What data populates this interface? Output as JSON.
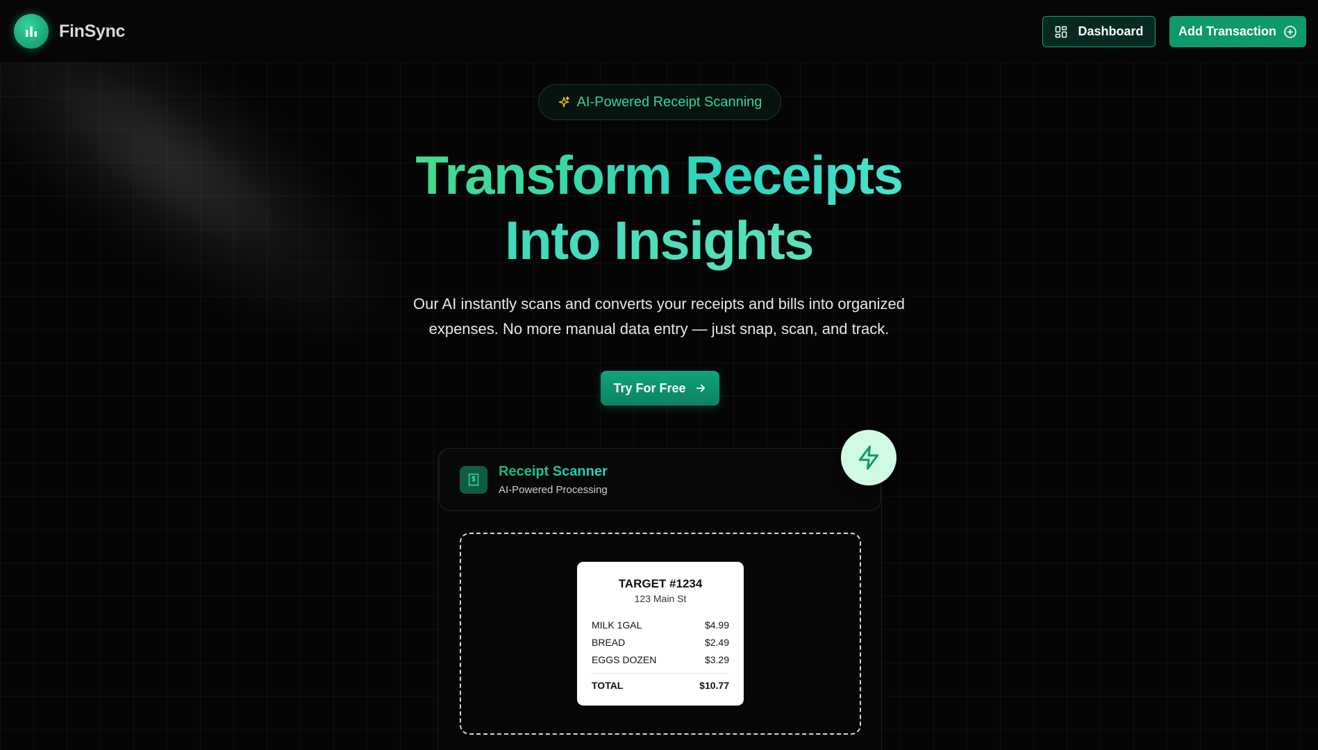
{
  "header": {
    "brand": "FinSync",
    "dashboard_label": "Dashboard",
    "add_transaction_label": "Add Transaction"
  },
  "hero": {
    "badge": "AI-Powered Receipt Scanning",
    "title_line1": "Transform Receipts",
    "title_line2": "Into Insights",
    "subtitle_line1": "Our AI instantly scans and converts your receipts and bills into organized",
    "subtitle_line2": "expenses. No more manual data entry — just snap, scan, and track.",
    "cta_label": "Try For Free"
  },
  "scanner": {
    "title": "Receipt Scanner",
    "subtitle": "AI-Powered Processing",
    "receipt": {
      "store": "TARGET #1234",
      "address": "123 Main St",
      "items": [
        {
          "name": "MILK 1GAL",
          "price": "$4.99"
        },
        {
          "name": "BREAD",
          "price": "$2.49"
        },
        {
          "name": "EGGS DOZEN",
          "price": "$3.29"
        }
      ],
      "total_label": "TOTAL",
      "total_value": "$10.77"
    }
  },
  "colors": {
    "accent": "#10b981",
    "accent_dark": "#0e9a6a",
    "background": "#050505"
  },
  "icons": {
    "logo": "bar-chart-icon",
    "dashboard": "grid-icon",
    "add": "plus-circle-icon",
    "badge": "sparkles-icon",
    "cta": "arrow-right-icon",
    "scanner": "receipt-icon",
    "bolt": "lightning-icon"
  }
}
